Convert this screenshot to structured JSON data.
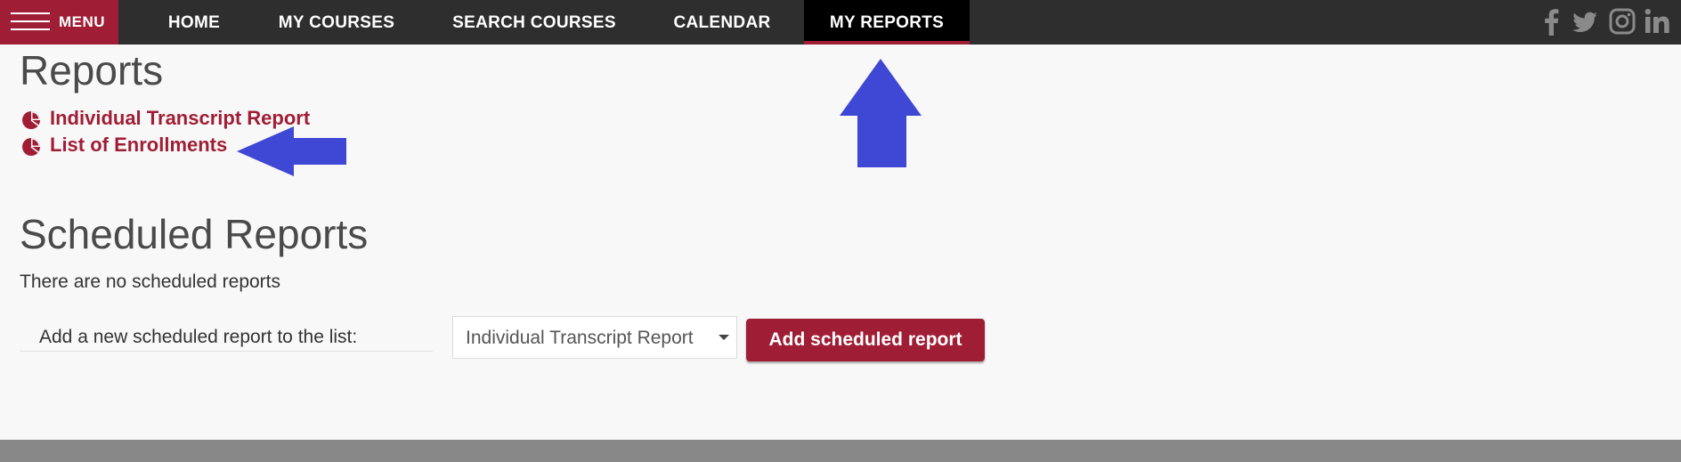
{
  "nav": {
    "menu_label": "MENU",
    "items": [
      {
        "label": "HOME"
      },
      {
        "label": "MY COURSES"
      },
      {
        "label": "SEARCH COURSES"
      },
      {
        "label": "CALENDAR"
      },
      {
        "label": "MY REPORTS",
        "active": true
      }
    ],
    "social_icons": [
      "facebook-icon",
      "twitter-icon",
      "instagram-icon",
      "linkedin-icon"
    ]
  },
  "reports": {
    "title": "Reports",
    "links": [
      {
        "label": "Individual Transcript Report",
        "icon": "pie-chart-icon"
      },
      {
        "label": "List of Enrollments",
        "icon": "pie-chart-icon"
      }
    ]
  },
  "scheduled": {
    "title": "Scheduled Reports",
    "empty_text": "There are no scheduled reports",
    "add_label": "Add a new scheduled report to the list:",
    "select_value": "Individual Transcript Report",
    "add_button": "Add scheduled report"
  },
  "colors": {
    "brand": "#a01e35",
    "nav_bg": "#2e2e2e",
    "annotation_arrow": "#3f48d4"
  }
}
